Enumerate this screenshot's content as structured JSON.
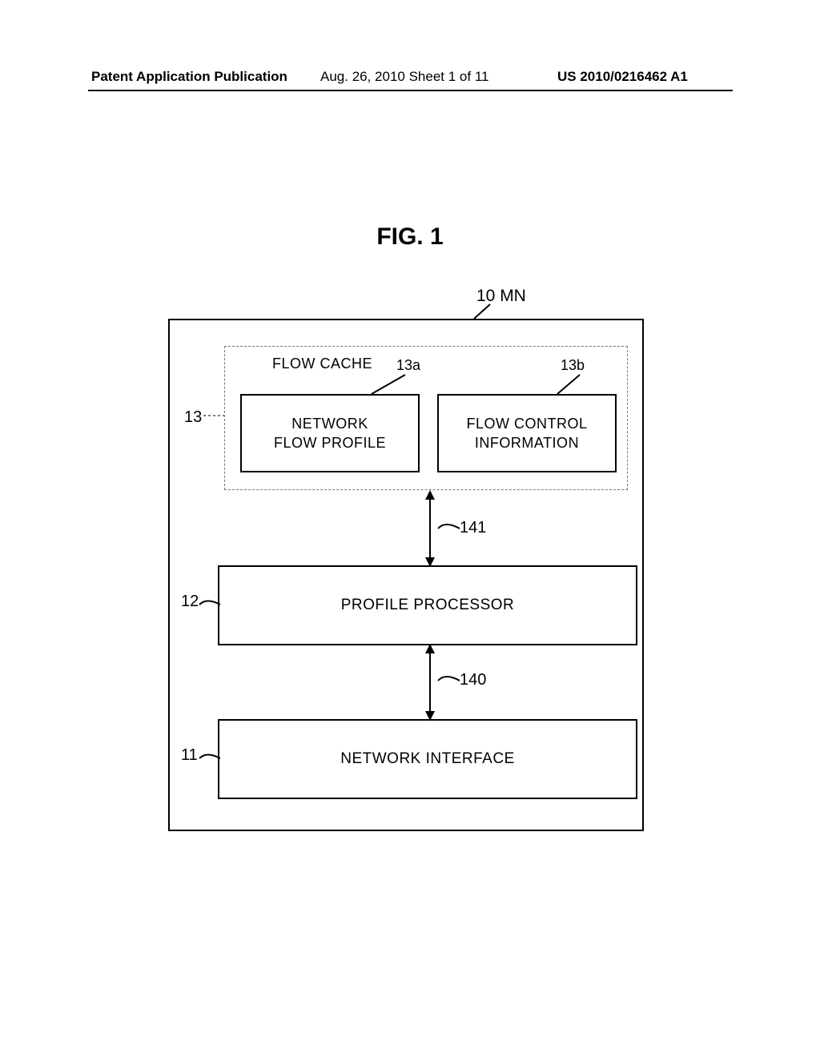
{
  "header": {
    "left": "Patent Application Publication",
    "center": "Aug. 26, 2010  Sheet 1 of 11",
    "right": "US 2010/0216462 A1"
  },
  "title": "FIG. 1",
  "labels": {
    "mn": "10 MN",
    "flow_cache": "FLOW CACHE",
    "l13a": "13a",
    "l13b": "13b",
    "l13": "13",
    "l12": "12",
    "l11": "11",
    "l141": "141",
    "l140": "140"
  },
  "boxes": {
    "nfp": "NETWORK\nFLOW PROFILE",
    "fci": "FLOW CONTROL\nINFORMATION",
    "pp": "PROFILE PROCESSOR",
    "ni": "NETWORK INTERFACE"
  }
}
